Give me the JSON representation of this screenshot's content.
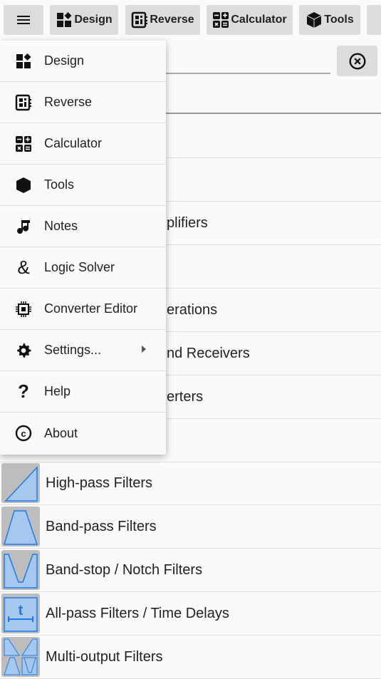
{
  "toolbar": {
    "buttons": [
      {
        "label": "Design",
        "icon": "design-icon"
      },
      {
        "label": "Reverse",
        "icon": "reverse-icon"
      },
      {
        "label": "Calculator",
        "icon": "calculator-icon"
      },
      {
        "label": "Tools",
        "icon": "tools-icon"
      }
    ]
  },
  "search": {
    "value": ""
  },
  "list": {
    "covered_rows": [
      "",
      "",
      "plifiers",
      "",
      "erations",
      "nd Receivers",
      "erters",
      ""
    ],
    "rows": [
      "High-pass Filters",
      "Band-pass Filters",
      "Band-stop / Notch Filters",
      "All-pass Filters / Time Delays",
      "Multi-output Filters"
    ]
  },
  "menu": {
    "items": [
      {
        "label": "Design",
        "icon": "design-icon"
      },
      {
        "label": "Reverse",
        "icon": "reverse-icon"
      },
      {
        "label": "Calculator",
        "icon": "calculator-icon"
      },
      {
        "label": "Tools",
        "icon": "tools-icon"
      },
      {
        "label": "Notes",
        "icon": "music-note-icon"
      },
      {
        "label": "Logic Solver",
        "icon": "ampersand-icon"
      },
      {
        "label": "Converter Editor",
        "icon": "chip-icon"
      },
      {
        "label": "Settings...",
        "icon": "gear-icon",
        "submenu": true
      },
      {
        "label": "Help",
        "icon": "help-icon"
      },
      {
        "label": "About",
        "icon": "copyright-icon"
      }
    ]
  },
  "colors": {
    "filter_fill": "#a6c8f0",
    "filter_stroke": "#1f7be8",
    "icon_bg": "#bdbdbd"
  }
}
